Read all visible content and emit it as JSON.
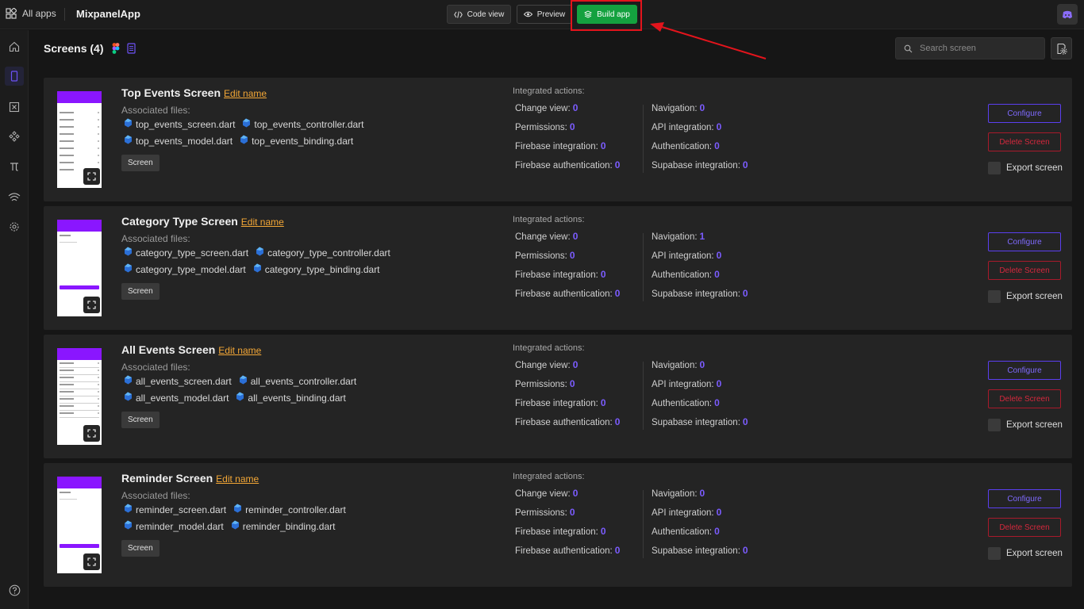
{
  "topbar": {
    "all_apps_label": "All apps",
    "app_title": "MixpanelApp",
    "code_view_label": "Code view",
    "preview_label": "Preview",
    "build_app_label": "Build app"
  },
  "header": {
    "title": "Screens (4)",
    "search_placeholder": "Search screen"
  },
  "common": {
    "associated_files_label": "Associated files:",
    "integrated_actions_label": "Integrated actions:",
    "edit_name_label": "Edit name",
    "tag_label": "Screen",
    "configure_label": "Configure",
    "delete_label": "Delete Screen",
    "export_label": "Export screen",
    "actions_left": [
      "Change view:",
      "Permissions:",
      "Firebase integration:",
      "Firebase authentication:"
    ],
    "actions_right": [
      "Navigation:",
      "API integration:",
      "Authentication:",
      "Supabase integration:"
    ]
  },
  "screens": [
    {
      "name": "Top Events Screen",
      "files": [
        "top_events_screen.dart",
        "top_events_controller.dart",
        "top_events_model.dart",
        "top_events_binding.dart"
      ],
      "left_values": [
        "0",
        "0",
        "0",
        "0"
      ],
      "right_values": [
        "0",
        "0",
        "0",
        "0"
      ]
    },
    {
      "name": "Category Type Screen",
      "files": [
        "category_type_screen.dart",
        "category_type_controller.dart",
        "category_type_model.dart",
        "category_type_binding.dart"
      ],
      "left_values": [
        "0",
        "0",
        "0",
        "0"
      ],
      "right_values": [
        "1",
        "0",
        "0",
        "0"
      ]
    },
    {
      "name": "All Events Screen",
      "files": [
        "all_events_screen.dart",
        "all_events_controller.dart",
        "all_events_model.dart",
        "all_events_binding.dart"
      ],
      "left_values": [
        "0",
        "0",
        "0",
        "0"
      ],
      "right_values": [
        "0",
        "0",
        "0",
        "0"
      ]
    },
    {
      "name": "Reminder Screen",
      "files": [
        "reminder_screen.dart",
        "reminder_controller.dart",
        "reminder_model.dart",
        "reminder_binding.dart"
      ],
      "left_values": [
        "0",
        "0",
        "0",
        "0"
      ],
      "right_values": [
        "0",
        "0",
        "0",
        "0"
      ]
    }
  ],
  "colors": {
    "accent": "#7b5cff",
    "build_green": "#14a13f",
    "highlight_red": "#e3141c",
    "edit_link": "#f3a736",
    "delete_red": "#d3283d"
  },
  "icons": [
    "apps-grid-icon",
    "code-icon",
    "eye-icon",
    "stack-icon",
    "discord-icon",
    "home-icon",
    "mobile-icon",
    "formula-icon",
    "components-icon",
    "pi-icon",
    "api-icon",
    "gear-icon",
    "help-icon",
    "search-icon",
    "figma-icon",
    "document-icon",
    "dart-file-icon",
    "expand-icon"
  ]
}
